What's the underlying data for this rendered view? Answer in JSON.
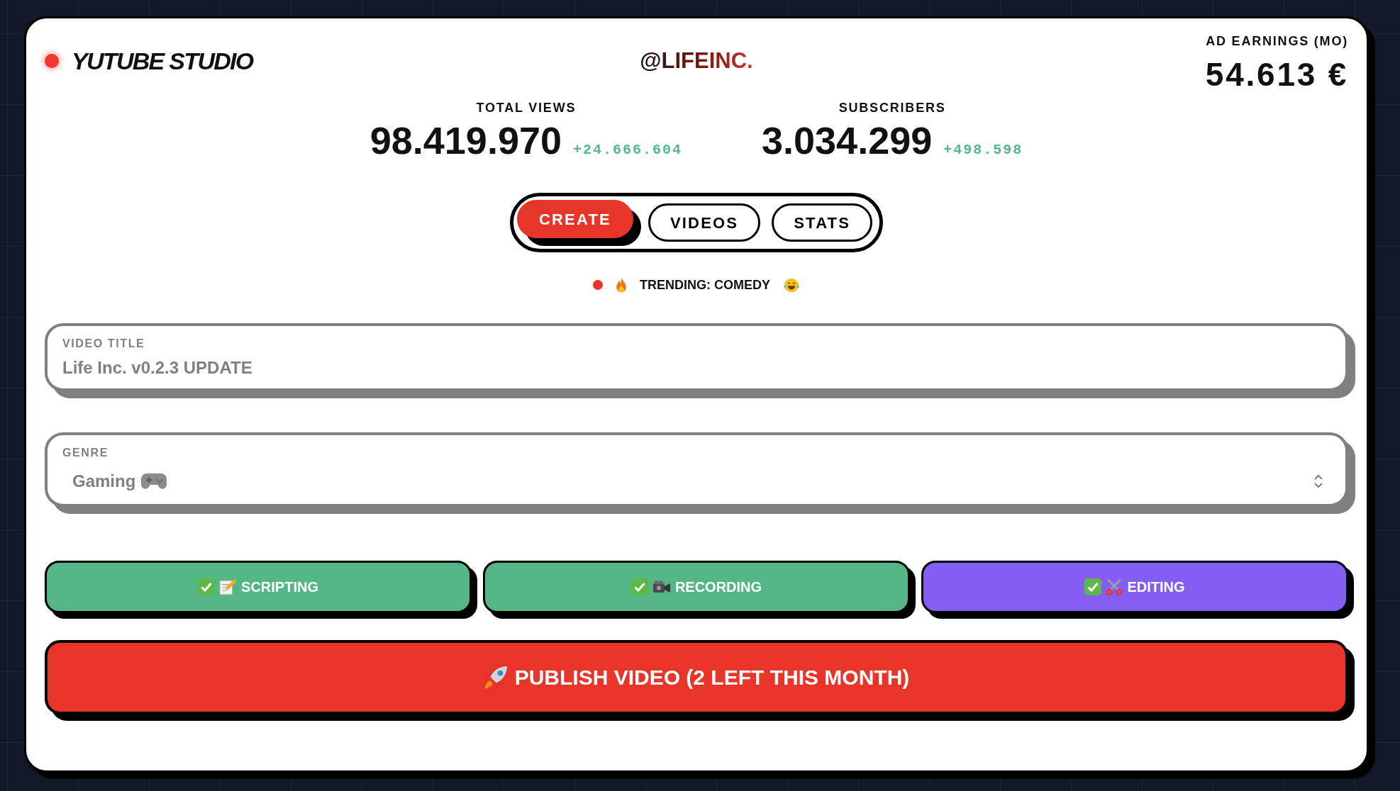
{
  "header": {
    "title": "YUTUBE STUDIO",
    "handle": "@LIFEINC.",
    "earnings": {
      "label": "AD EARNINGS (MO)",
      "value": "54.613 €"
    }
  },
  "stats": [
    {
      "label": "TOTAL VIEWS",
      "value": "98.419.970",
      "change": "+24.666.604"
    },
    {
      "label": "SUBSCRIBERS",
      "value": "3.034.299",
      "change": "+498.598"
    }
  ],
  "tabs": [
    {
      "label": "CREATE",
      "selected": true
    },
    {
      "label": "VIDEOS",
      "selected": false
    },
    {
      "label": "STATS",
      "selected": false
    }
  ],
  "trending": {
    "text": "TRENDING: COMEDY"
  },
  "form": {
    "title_field": {
      "label": "VIDEO TITLE",
      "value": "Life Inc. v0.2.3 UPDATE",
      "disabled": true
    },
    "genre_field": {
      "label": "GENRE",
      "value": "Gaming",
      "disabled": true
    }
  },
  "steps": [
    {
      "label": "SCRIPTING",
      "done": true,
      "color": "#55b685"
    },
    {
      "label": "RECORDING",
      "done": true,
      "color": "#55b685"
    },
    {
      "label": "EDITING",
      "done": true,
      "color": "#845ef0"
    }
  ],
  "publish_button": {
    "label": "PUBLISH VIDEO (2 LEFT THIS MONTH)"
  }
}
